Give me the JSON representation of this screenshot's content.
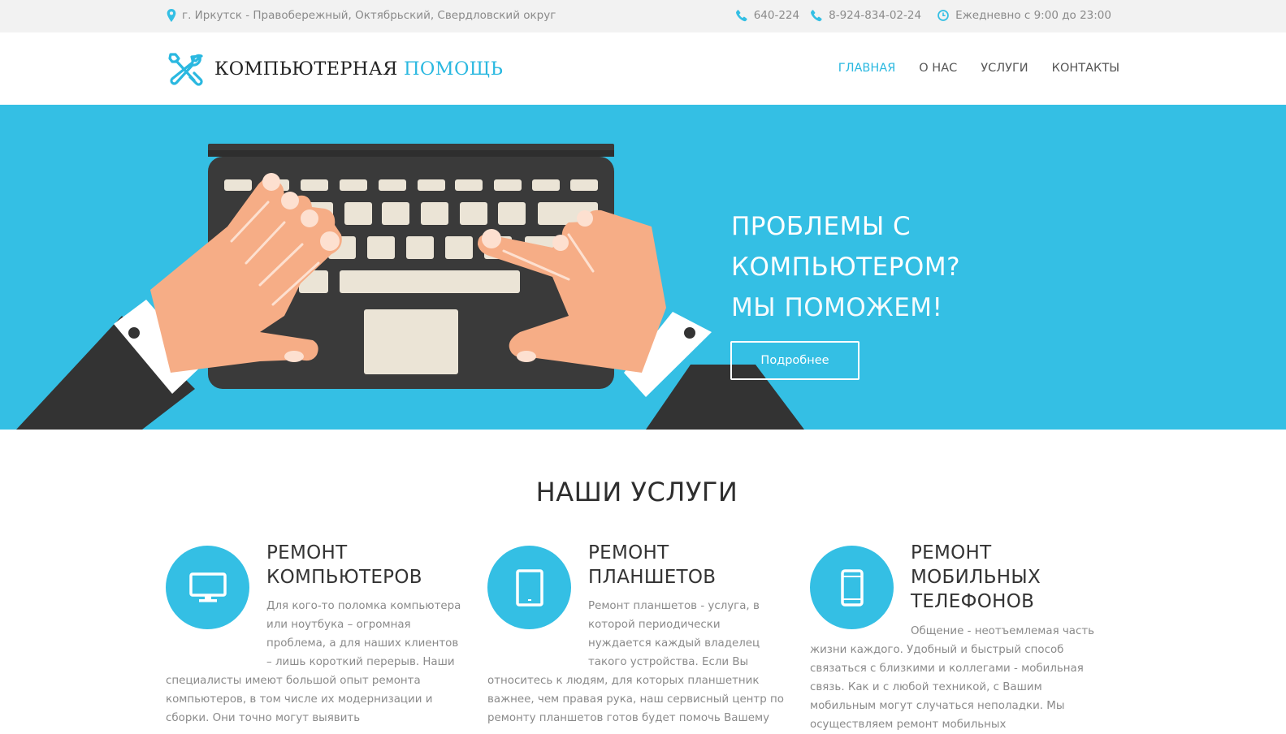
{
  "topbar": {
    "address": "г. Иркутск - Правобережный, Октябрьский, Свердловский округ",
    "phone1": "640-224",
    "phone2": "8-924-834-02-24",
    "hours": "Ежедневно с 9:00 до 23:00",
    "address_icon": "map-marker-icon",
    "phone_icon": "phone-icon",
    "hours_icon": "clock-icon"
  },
  "logo": {
    "text_main": "КОМПЬЮТЕРНАЯ",
    "text_accent": "ПОМОЩЬ",
    "icon": "tools-icon"
  },
  "nav": {
    "items": [
      {
        "label": "ГЛАВНАЯ",
        "active": true
      },
      {
        "label": "О НАС",
        "active": false
      },
      {
        "label": "УСЛУГИ",
        "active": false
      },
      {
        "label": "КОНТАКТЫ",
        "active": false
      }
    ]
  },
  "hero": {
    "line1": "ПРОБЛЕМЫ С",
    "line2": "КОМПЬЮТЕРОМ?",
    "line3": "МЫ ПОМОЖЕМ!",
    "button_label": "Подробнее"
  },
  "services": {
    "title": "НАШИ УСЛУГИ",
    "items": [
      {
        "icon": "monitor-icon",
        "title_line1": "РЕМОНТ",
        "title_line2": "КОМПЬЮТЕРОВ",
        "title_line3": "",
        "text": "Для кого-то поломка компьютера или ноутбука – огромная проблема, а для наших клиентов – лишь короткий перерыв. Наши специалисты имеют большой опыт ремонта компьютеров, в том числе их модернизации и сборки. Они точно могут выявить"
      },
      {
        "icon": "tablet-icon",
        "title_line1": "РЕМОНТ",
        "title_line2": "ПЛАНШЕТОВ",
        "title_line3": "",
        "text": "Ремонт планшетов - услуга, в которой периодически нуждается каждый владелец такого устройства. Если Вы относитесь к людям, для которых планшетник важнее, чем правая рука, наш сервисный центр по ремонту планшетов готов будет помочь Вашему"
      },
      {
        "icon": "mobile-phone-icon",
        "title_line1": "РЕМОНТ",
        "title_line2": "МОБИЛЬНЫХ",
        "title_line3": "ТЕЛЕФОНОВ",
        "text": "Общение - неотъемлемая часть жизни каждого. Удобный и быстрый способ связаться с близкими и коллегами - мобильная связь. Как и с любой техникой, с Вашим мобильным могут случаться неполадки. Мы осуществляем ремонт мобильных"
      }
    ]
  },
  "colors": {
    "accent": "#2ab8e0",
    "hero_bg": "#34bfe4",
    "topbar_bg": "#f2f2f2"
  }
}
